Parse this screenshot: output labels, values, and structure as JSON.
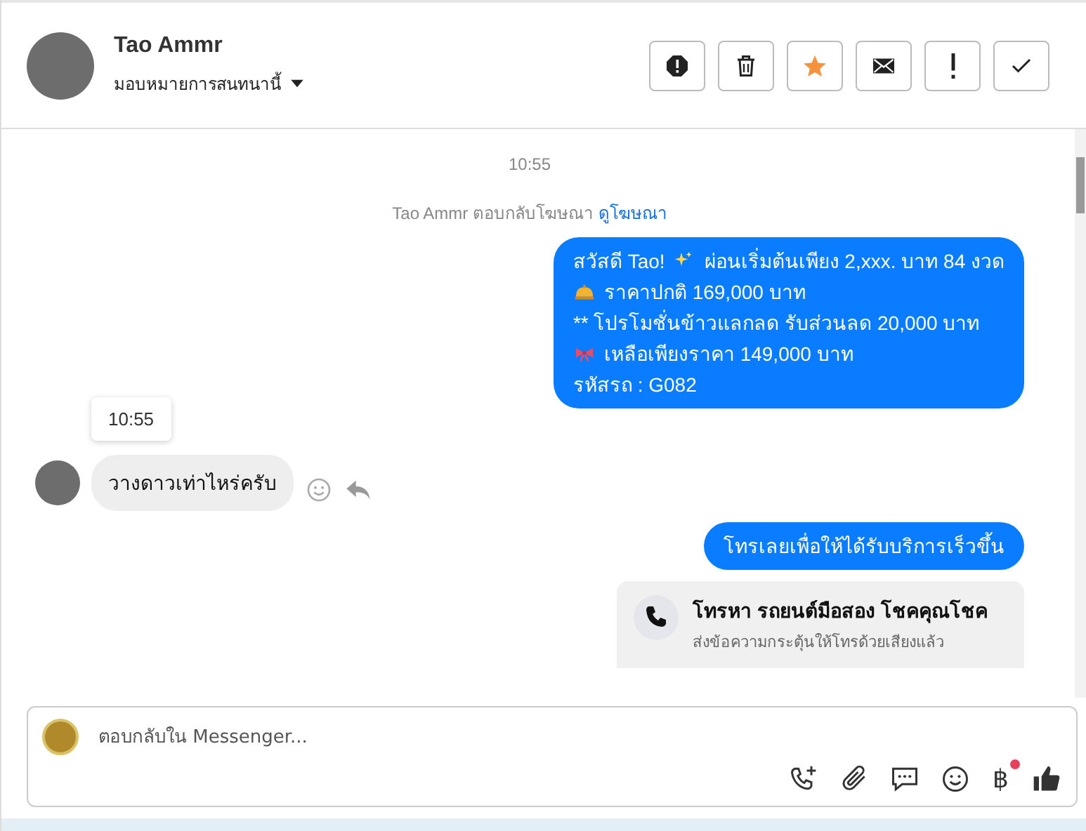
{
  "header": {
    "name": "Tao Ammr",
    "assign_label": "มอบหมายการสนทนานี้",
    "actions": [
      {
        "kind": "spam"
      },
      {
        "kind": "delete"
      },
      {
        "kind": "star",
        "active": true
      },
      {
        "kind": "mail"
      },
      {
        "kind": "important"
      },
      {
        "kind": "done"
      }
    ]
  },
  "conversation": {
    "time": "10:55",
    "notice": "Tao Ammr ตอบกลับโฆษณา",
    "notice_link": "ดูโฆษณา",
    "messages": [
      {
        "kind": "outgoing",
        "lines": [
          {
            "kind": "with_emoji",
            "text": "สวัสดี Tao!",
            "after": "ผ่อนเริ่มต้นเพียง 2,xxx. บาท 84 งวด"
          },
          {
            "kind": "with_emoji",
            "after": "ราคาปกติ 169,000 บาท"
          },
          {
            "kind": "plain",
            "text": "** โปรโมชั่นข้าวแลกลด รับส่วนลด 20,000 บาท"
          },
          {
            "kind": "with_emoji",
            "after": "เหลือเพียงราคา 149,000 บาท"
          },
          {
            "kind": "plain",
            "text": "รหัสรถ : G082"
          }
        ]
      },
      {
        "kind": "incoming",
        "tooltip": "10:55",
        "text": "วางดาวเท่าไหร่ครับ"
      },
      {
        "kind": "outgoing",
        "lines": [
          {
            "kind": "plain",
            "text": "โทรเลยเพื่อให้ได้รับบริการเร็วขึ้น"
          }
        ]
      },
      {
        "kind": "call_card",
        "title": "โทรหา รถยนต์มือสอง โชคคุณโชค",
        "subtitle": "ส่งข้อความกระตุ้นให้โทรด้วยเสียงแล้ว"
      }
    ]
  },
  "composer": {
    "placeholder": "ตอบกลับใน Messenger...",
    "currency_symbol": "฿",
    "currency_notification": true
  }
}
